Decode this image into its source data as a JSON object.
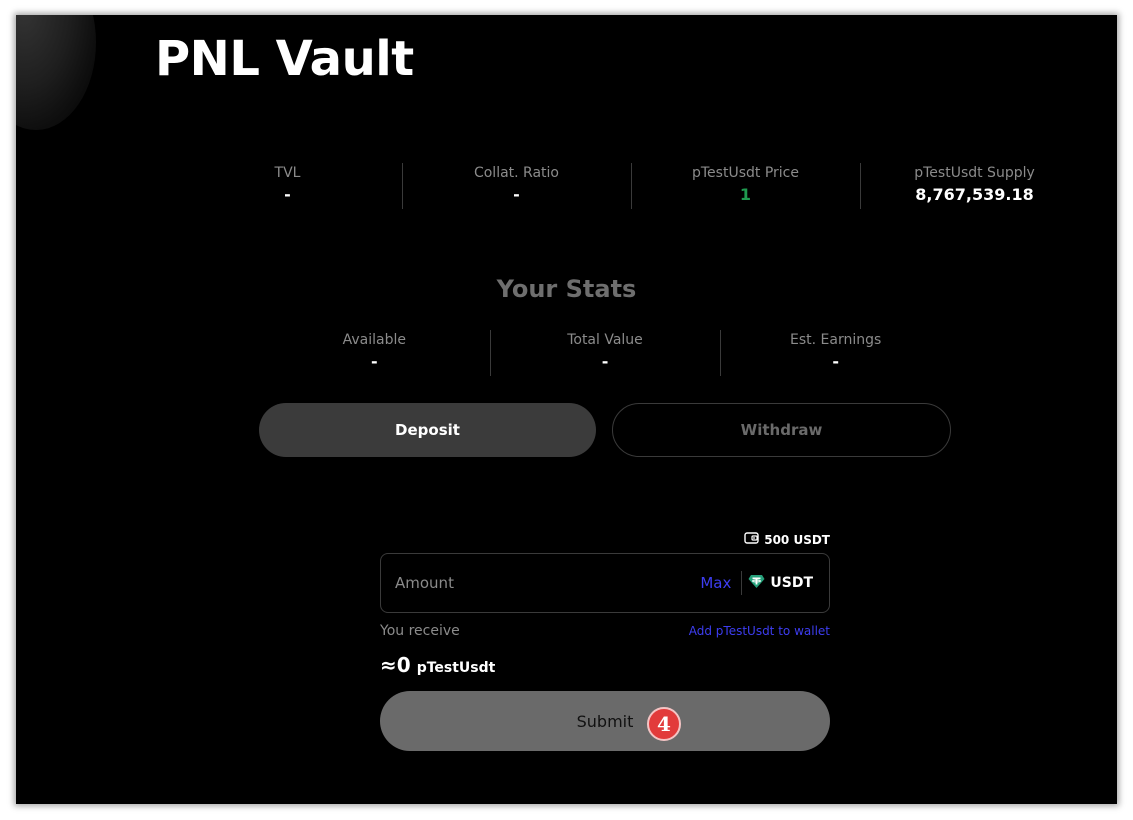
{
  "page": {
    "title": "PNL Vault"
  },
  "vault_stats": [
    {
      "label": "TVL",
      "value": "-"
    },
    {
      "label": "Collat. Ratio",
      "value": "-"
    },
    {
      "label": "pTestUsdt Price",
      "value": "1"
    },
    {
      "label": "pTestUsdt Supply",
      "value": "8,767,539.18"
    }
  ],
  "your_stats": {
    "heading": "Your Stats",
    "items": [
      {
        "label": "Available",
        "value": "-"
      },
      {
        "label": "Total Value",
        "value": "-"
      },
      {
        "label": "Est. Earnings",
        "value": "-"
      }
    ]
  },
  "tabs": {
    "deposit": "Deposit",
    "withdraw": "Withdraw"
  },
  "form": {
    "balance": "500 USDT",
    "amount_placeholder": "Amount",
    "max_label": "Max",
    "token": "USDT",
    "receive_label": "You receive",
    "add_link": "Add pTestUsdt to wallet",
    "receive_approx": "≈0",
    "receive_unit": "pTestUsdt",
    "submit_label": "Submit"
  },
  "annotation": {
    "step_number": "4"
  },
  "colors": {
    "background": "#000000",
    "price_green": "#1f9a4f",
    "link_blue": "#3d3df0",
    "annotation_red": "#e23b3b"
  },
  "icons": {
    "wallet": "wallet-icon",
    "token": "tether-icon"
  }
}
